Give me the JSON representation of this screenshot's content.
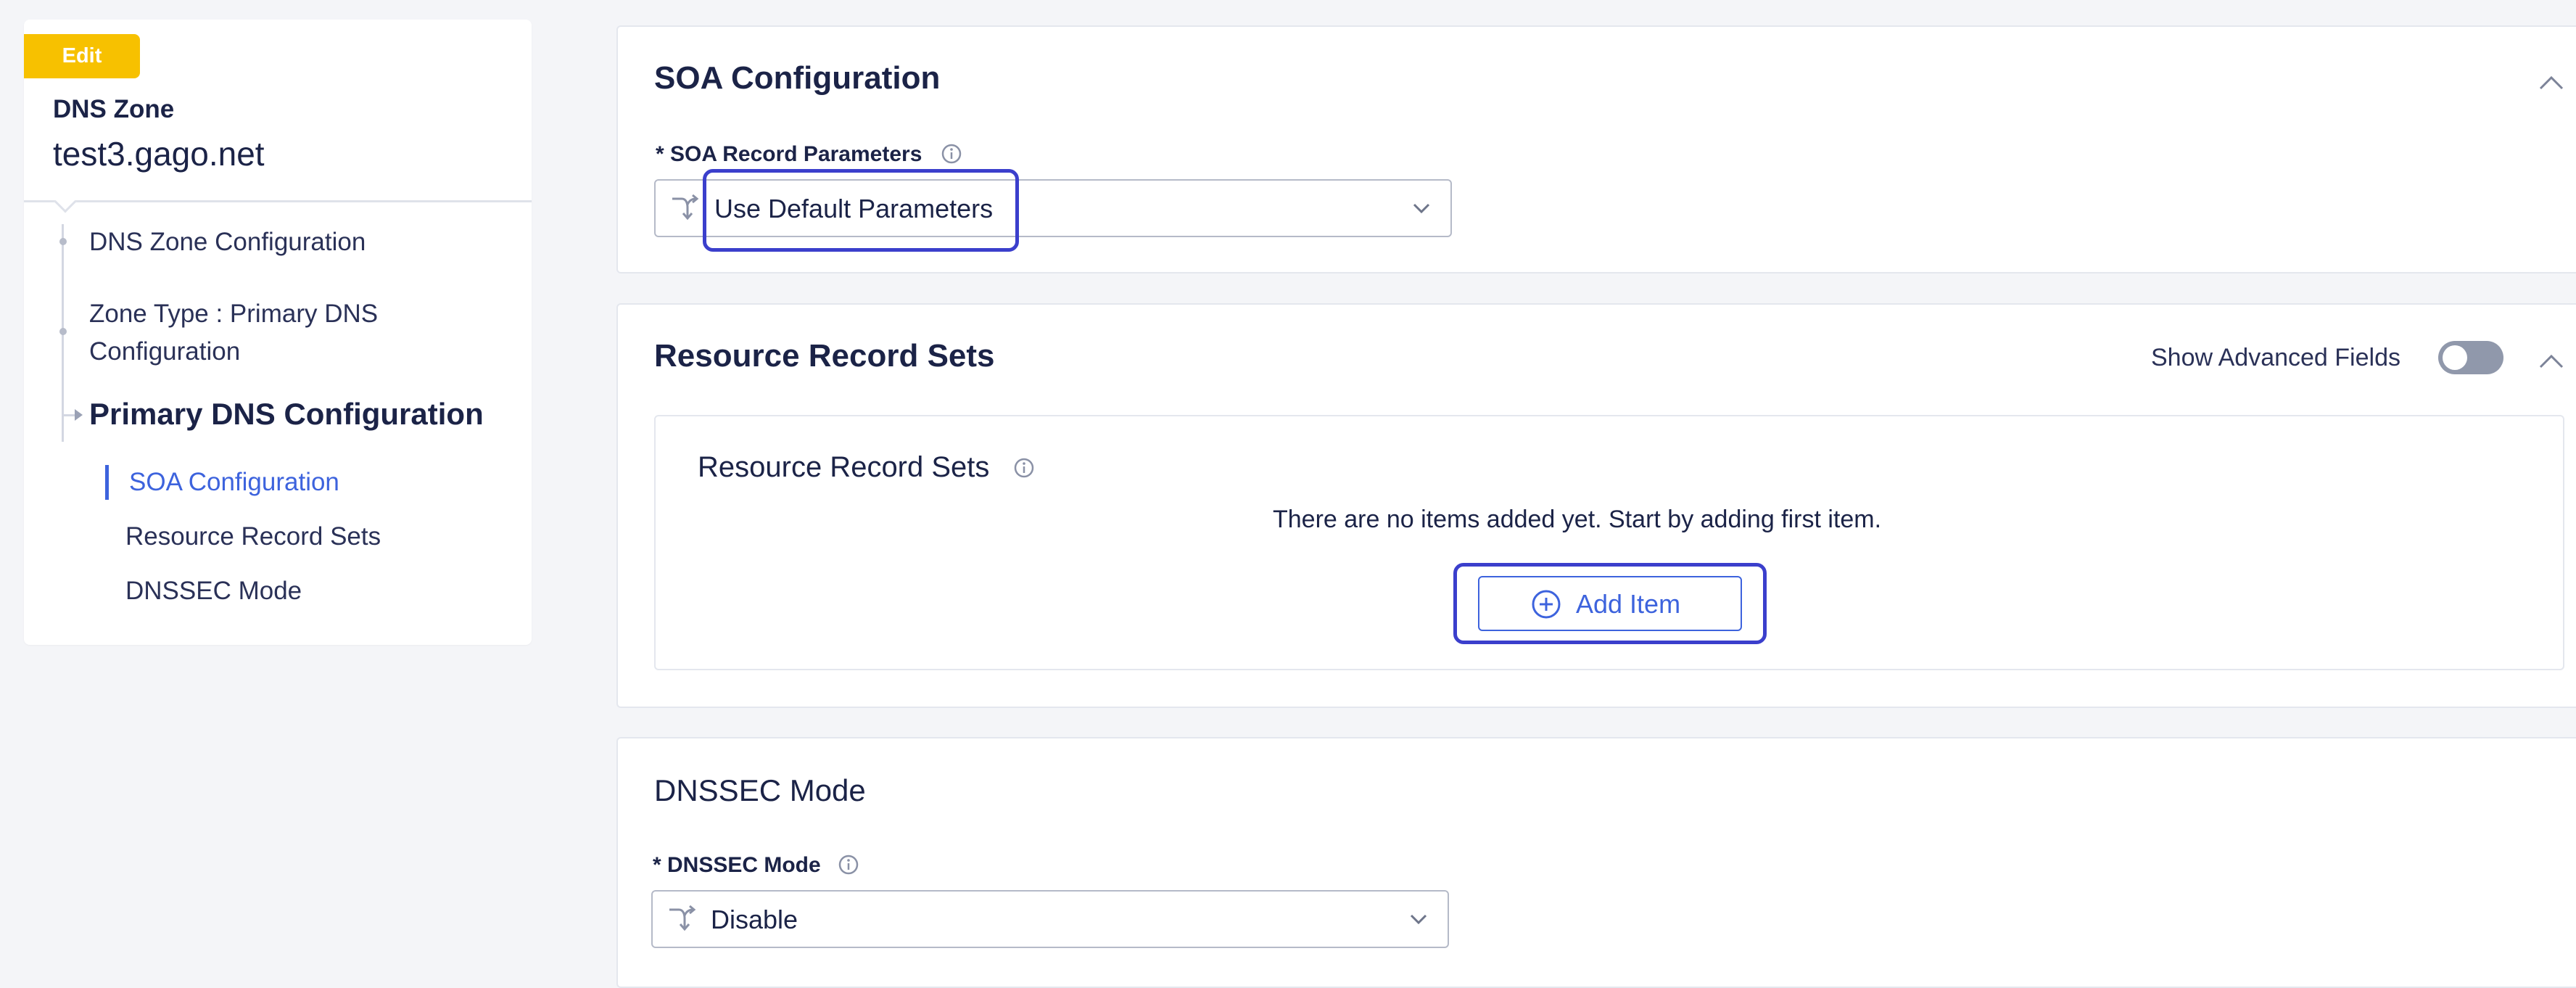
{
  "sidebar": {
    "badge": "Edit",
    "zone_label": "DNS Zone",
    "zone_name": "test3.gago.net",
    "nav": {
      "dns_zone_config": "DNS Zone Configuration",
      "zone_type_line1": "Zone Type : Primary DNS",
      "zone_type_line2": "Configuration",
      "primary_dns": "Primary DNS Configuration",
      "soa": "SOA Configuration",
      "rrs": "Resource Record Sets",
      "dnssec": "DNSSEC Mode"
    }
  },
  "soa": {
    "title": "SOA Configuration",
    "field_label": "* SOA Record Parameters",
    "select_value": "Use Default Parameters"
  },
  "rrs": {
    "title": "Resource Record Sets",
    "advanced_label": "Show Advanced Fields",
    "advanced_enabled": false,
    "inner_title": "Resource Record Sets",
    "empty_message": "There are no items added yet. Start by adding first item.",
    "add_button": "Add Item"
  },
  "dnssec": {
    "title": "DNSSEC Mode",
    "field_label": "* DNSSEC Mode",
    "select_value": "Disable"
  },
  "colors": {
    "accent": "#3d63dd",
    "badge": "#f7c100",
    "highlight": "#3b3fcc",
    "toggle_off": "#9098ab"
  },
  "icons": [
    "info-icon",
    "chevron-up-icon",
    "chevron-down-icon",
    "route-icon",
    "plus-circle-icon"
  ]
}
